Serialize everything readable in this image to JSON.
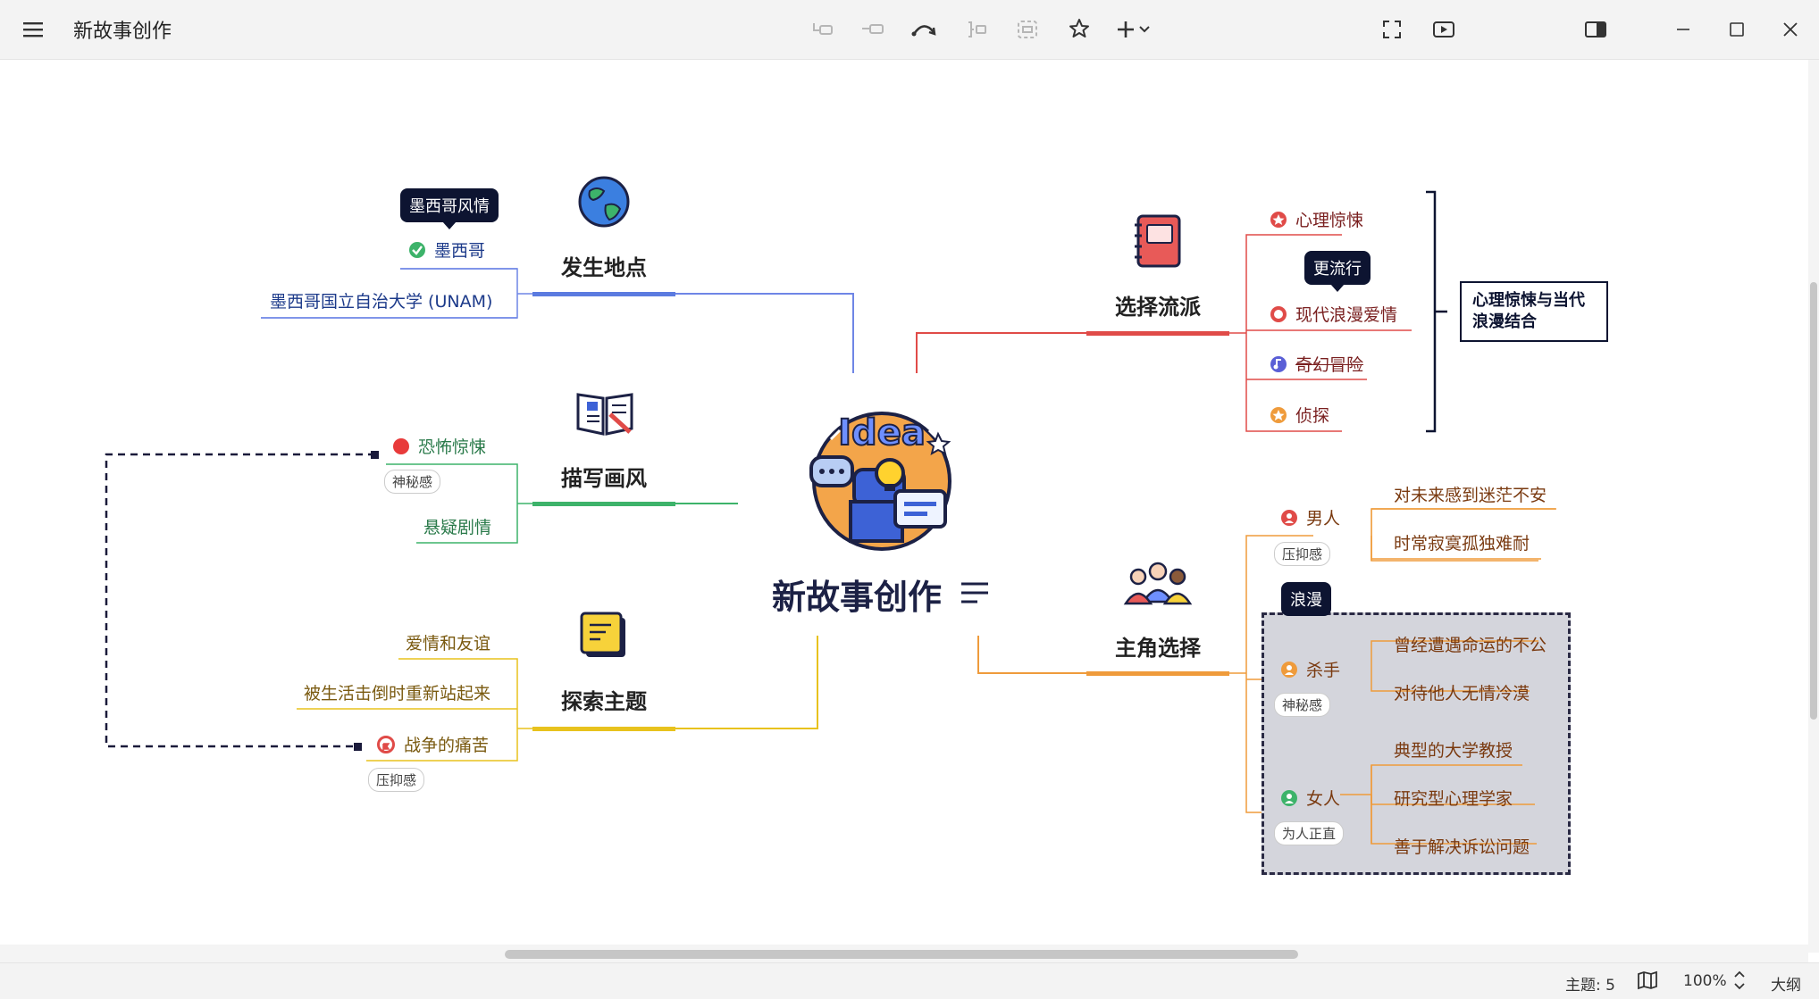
{
  "window": {
    "title": "新故事创作"
  },
  "toolbar": {
    "icons": [
      "menu-icon",
      "insert-topic-icon",
      "insert-subtopic-icon",
      "relationship-icon",
      "summary-icon",
      "boundary-icon",
      "marker-star-icon",
      "add-icon",
      "fullscreen-icon",
      "presentation-icon",
      "panel-toggle-icon",
      "minimize-icon",
      "maximize-icon",
      "close-icon"
    ]
  },
  "map": {
    "central": {
      "title": "新故事创作",
      "image": "Idea"
    },
    "left": [
      {
        "title": "发生地点",
        "color": "#5b7be0",
        "children": [
          {
            "text": "墨西哥",
            "marker": "check-icon",
            "callout": "墨西哥风情"
          },
          {
            "text": "墨西哥国立自治大学 (UNAM)"
          }
        ]
      },
      {
        "title": "描写画风",
        "color": "#3db36a",
        "children": [
          {
            "text": "恐怖惊悚",
            "marker": "red-dot-icon",
            "label": "神秘感"
          },
          {
            "text": "悬疑剧情"
          }
        ]
      },
      {
        "title": "探索主题",
        "color": "#e8c21d",
        "children": [
          {
            "text": "爱情和友谊"
          },
          {
            "text": "被生活击倒时重新站起来"
          },
          {
            "text": "战争的痛苦",
            "marker": "flag-icon",
            "label": "压抑感"
          }
        ]
      }
    ],
    "right": [
      {
        "title": "选择流派",
        "color": "#e04b48",
        "children": [
          {
            "text": "心理惊悚",
            "marker": "star-icon"
          },
          {
            "text": "现代浪漫爱情",
            "marker": "heart-icon",
            "callout": "更流行"
          },
          {
            "text": "奇幻冒险",
            "marker": "music-icon",
            "strikethrough": true
          },
          {
            "text": "侦探",
            "marker": "star-orange-icon"
          }
        ],
        "summary": "心理惊悚与当代浪漫结合"
      },
      {
        "title": "主角选择",
        "color": "#ef9b3b",
        "children": [
          {
            "text": "男人",
            "label": "压抑感",
            "children": [
              "对未来感到迷茫不安",
              "时常寂寞孤独难耐"
            ]
          },
          {
            "text": "杀手",
            "label": "神秘感",
            "children": [
              "曾经遭遇命运的不公",
              "对待他人无情冷漠"
            ]
          },
          {
            "text": "女人",
            "label": "为人正直",
            "children": [
              "典型的大学教授",
              "研究型心理学家",
              "善于解决诉讼问题"
            ]
          }
        ],
        "boundary_label": "浪漫"
      }
    ]
  },
  "status": {
    "topics": "主题: 5",
    "zoom": "100%",
    "outline": "大纲"
  }
}
